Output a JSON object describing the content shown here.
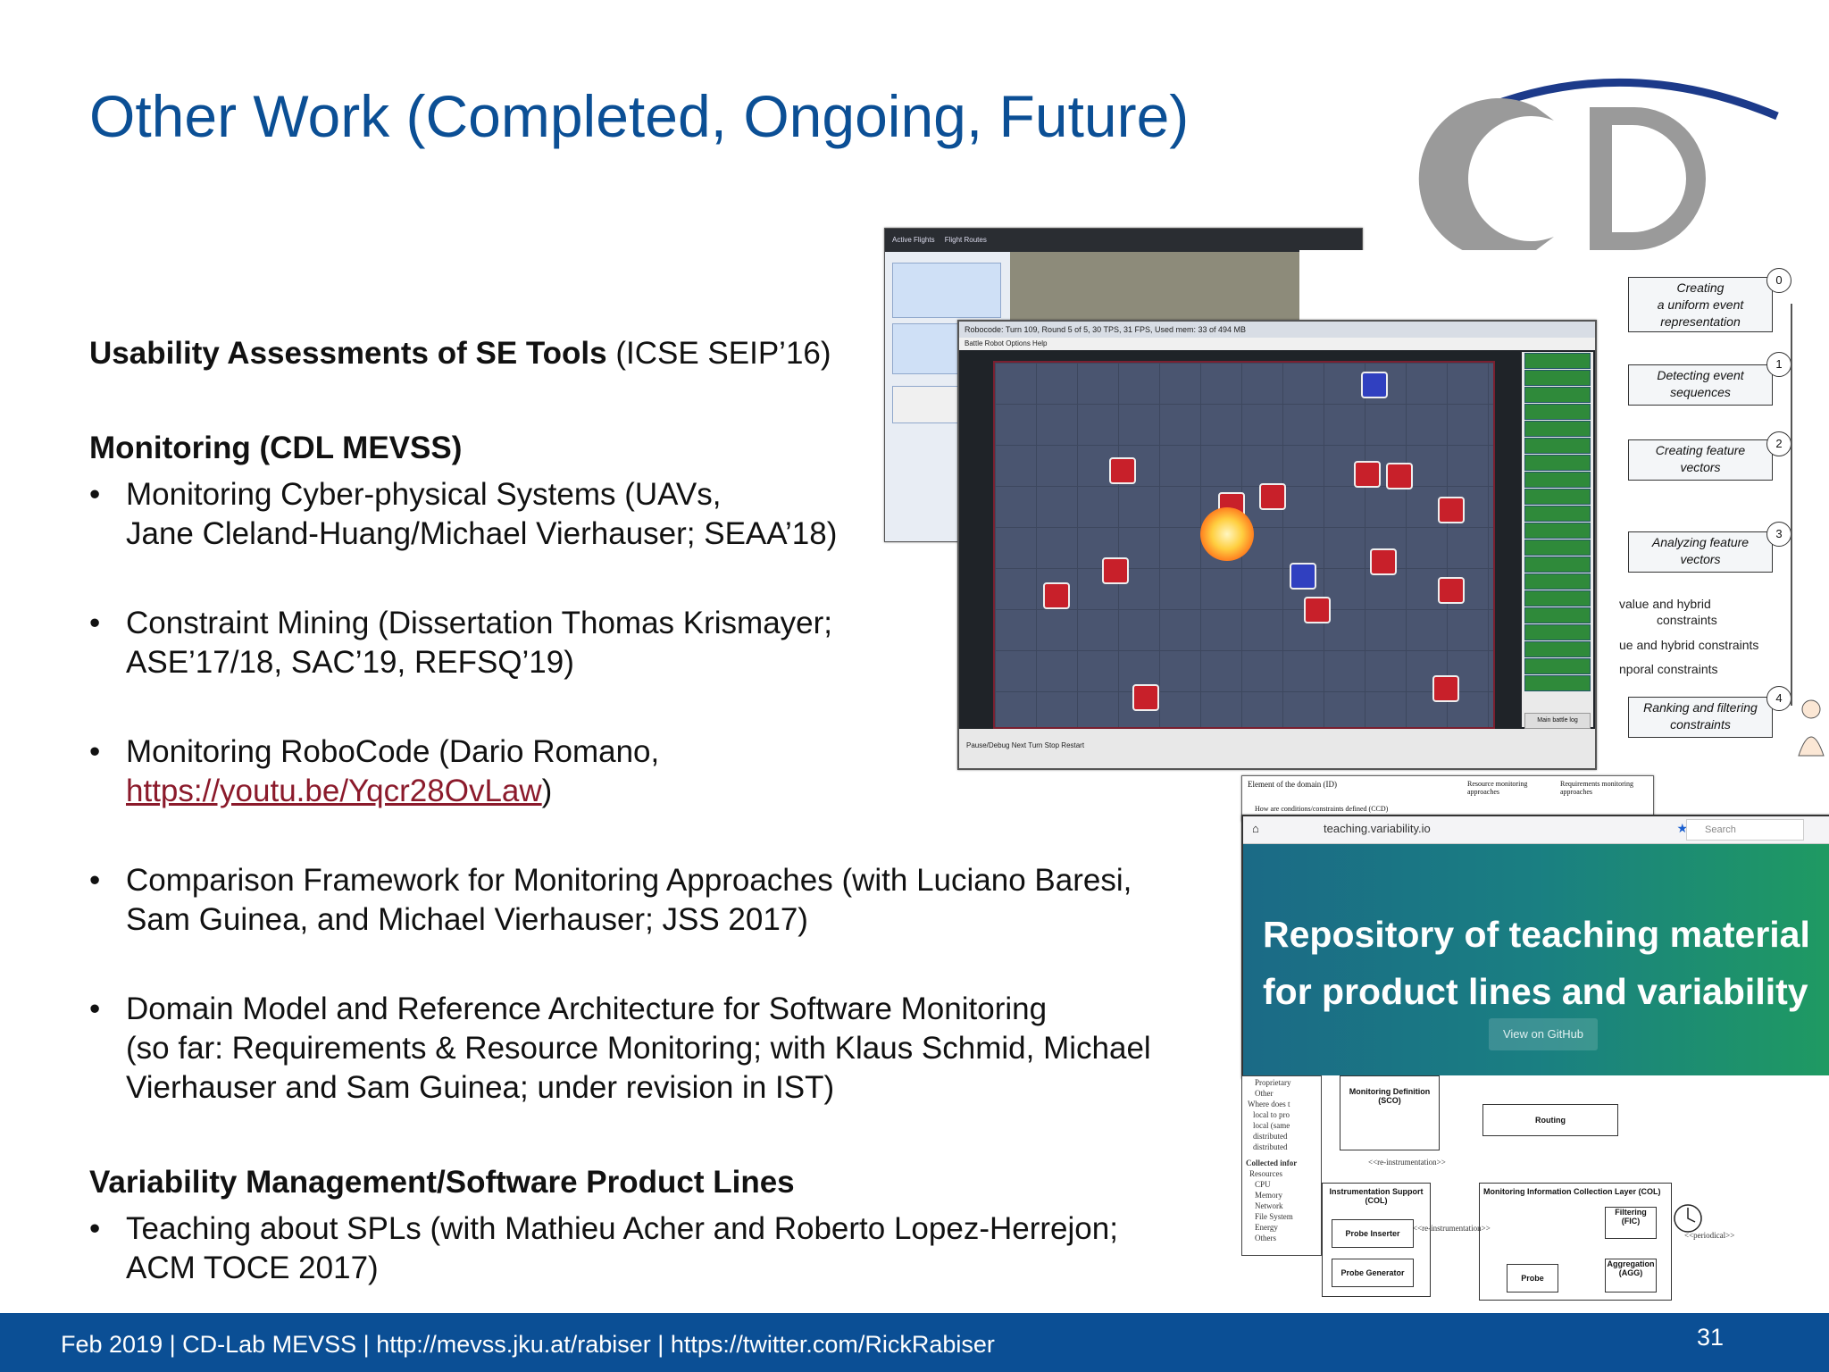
{
  "slide": {
    "title": "Other Work (Completed, Ongoing, Future)",
    "sections": [
      {
        "heading": "Usability Assessments of SE Tools",
        "heading_suffix": " (ICSE SEIP’16)"
      },
      {
        "heading": "Monitoring (CDL MEVSS)",
        "items": [
          [
            "Monitoring Cyber-physical Systems (UAVs,",
            "Jane Cleland-Huang/Michael Vierhauser; SEAA’18)"
          ],
          [
            "Constraint Mining (Dissertation Thomas Krismayer;",
            "ASE’17/18, SAC’19, REFSQ’19)"
          ],
          [
            "Monitoring RoboCode (Dario Romano,",
            "https://youtu.be/Yqcr28OvLaw",
            ")"
          ],
          [
            "Comparison Framework for Monitoring Approaches (with Luciano Baresi,",
            "Sam Guinea, and Michael Vierhauser; JSS 2017)"
          ],
          [
            "Domain Model and Reference Architecture for Software Monitoring",
            "(so far: Requirements & Resource Monitoring; with Klaus Schmid, Michael",
            "Vierhauser and Sam Guinea; under revision in IST)"
          ]
        ]
      },
      {
        "heading": "Variability Management/Software Product Lines",
        "items": [
          [
            "Teaching about SPLs (with Mathieu Acher and Roberto Lopez-Herrejon;",
            "ACM TOCE 2017)"
          ]
        ]
      }
    ],
    "bullet": "•"
  },
  "footer": {
    "text": "Feb 2019 |  CD-Lab MEVSS | http://mevss.jku.at/rabiser | https://twitter.com/RickRabiser",
    "page": "31"
  },
  "collage": {
    "flight_tabs": [
      "Active Flights",
      "Flight Routes"
    ],
    "robocode_title": "Robocode: Turn 109, Round 5 of 5, 30 TPS, 31 FPS, Used mem: 33 of 494 MB",
    "robocode_menu": "Battle   Robot   Options   Help",
    "robocode_controls": "Pause/Debug   Next Turn   Stop   Restart",
    "robocode_log": "Main battle log",
    "pipeline": [
      {
        "n": "0",
        "label": [
          "Creating",
          "a uniform event",
          "representation"
        ]
      },
      {
        "n": "1",
        "label": [
          "Detecting event",
          "sequences"
        ]
      },
      {
        "n": "2",
        "label": [
          "Creating feature",
          "vectors"
        ]
      },
      {
        "n": "3",
        "label": [
          "Analyzing feature",
          "vectors"
        ]
      },
      {
        "n": "4",
        "label": [
          "Ranking and filtering",
          "constraints"
        ]
      }
    ],
    "pipeline_notes": [
      "value and hybrid",
      "constraints",
      "ue and hybrid constraints",
      "nporal constraints"
    ],
    "table_headers": [
      "Element of the domain (ID)",
      "Resource monitoring approaches",
      "Requirements monitoring approaches"
    ],
    "table_row": "How are conditions/constraints defined (CCD)",
    "browser_url": "teaching.variability.io",
    "browser_search": "Search",
    "banner_lines": [
      "Repository of teaching material",
      "for product lines and variability"
    ],
    "banner_button": "View on GitHub",
    "arch_boxes": [
      "Monitoring Definition (SCO)",
      "Routing",
      "Instrumentation Support (COL)",
      "Probe Inserter",
      "Probe Generator",
      "Monitoring Information Collection Layer (COL)",
      "Filtering (FIC)",
      "Probe",
      "Aggregation (AGG)"
    ],
    "arch_labels": [
      "<<re-instrumentation>>",
      "<<periodical>>"
    ],
    "arch_list": [
      "Proprietary",
      "Other",
      "Where does t",
      "local to pro",
      "local (same",
      "distributed",
      "distributed",
      "Collected infor",
      "Resources",
      "CPU",
      "Memory",
      "Network",
      "File System",
      "Energy",
      "Others"
    ]
  }
}
